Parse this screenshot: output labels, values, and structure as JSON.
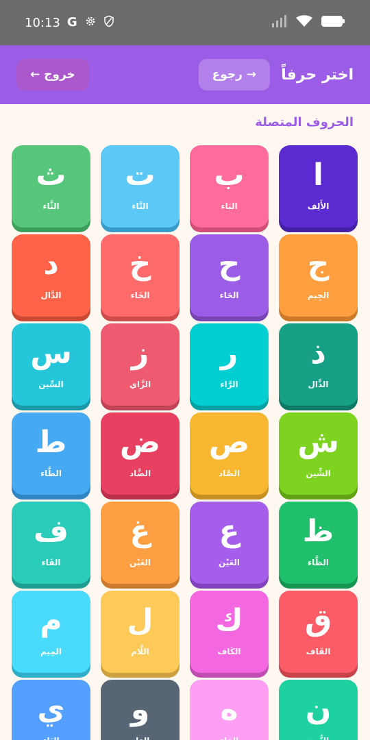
{
  "status": {
    "time": "10:13"
  },
  "header": {
    "title": "اختر حرفاً",
    "back_label": "→ رجوع",
    "exit_label": "خروج ←"
  },
  "section": {
    "title": "الحروف المتصلة"
  },
  "letters": [
    {
      "char": "ا",
      "name": "الأَلِف",
      "color": "#5B2BD1",
      "shade": "#4420A6"
    },
    {
      "char": "ب",
      "name": "البَاء",
      "color": "#FF6B9A",
      "shade": "#D14E78"
    },
    {
      "char": "ت",
      "name": "التَّاء",
      "color": "#5CC8F5",
      "shade": "#3A9BC7"
    },
    {
      "char": "ث",
      "name": "الثَّاء",
      "color": "#56C77A",
      "shade": "#3C9E5B"
    },
    {
      "char": "ج",
      "name": "الجِيم",
      "color": "#FF9F40",
      "shade": "#CC7A2A"
    },
    {
      "char": "ح",
      "name": "الحَاء",
      "color": "#9B5DE5",
      "shade": "#7845B5"
    },
    {
      "char": "خ",
      "name": "الخَاء",
      "color": "#FF6B6B",
      "shade": "#CF4C4C"
    },
    {
      "char": "د",
      "name": "الدَّال",
      "color": "#FF6347",
      "shade": "#CC4A33"
    },
    {
      "char": "ذ",
      "name": "الذَّال",
      "color": "#16A085",
      "shade": "#0E7A65"
    },
    {
      "char": "ر",
      "name": "الرَّاء",
      "color": "#00CED1",
      "shade": "#00A0A3"
    },
    {
      "char": "ز",
      "name": "الزَّاي",
      "color": "#EE5A6F",
      "shade": "#C04356"
    },
    {
      "char": "س",
      "name": "السِّين",
      "color": "#26C6DA",
      "shade": "#1A98A8"
    },
    {
      "char": "ش",
      "name": "الشِّين",
      "color": "#7ED321",
      "shade": "#5FA315"
    },
    {
      "char": "ص",
      "name": "الصَّاد",
      "color": "#F7B731",
      "shade": "#C68F1F"
    },
    {
      "char": "ض",
      "name": "الضَّاد",
      "color": "#E84060",
      "shade": "#B92E49"
    },
    {
      "char": "ط",
      "name": "الطَّاء",
      "color": "#45AAF2",
      "shade": "#2F84C2"
    },
    {
      "char": "ظ",
      "name": "الظَّاء",
      "color": "#20BF6B",
      "shade": "#159452"
    },
    {
      "char": "ع",
      "name": "العَيْن",
      "color": "#A55EEA",
      "shade": "#8043BD"
    },
    {
      "char": "غ",
      "name": "الغَيْن",
      "color": "#FF9F43",
      "shade": "#CC7B2E"
    },
    {
      "char": "ف",
      "name": "الفَاء",
      "color": "#2BCBBA",
      "shade": "#1D9E90"
    },
    {
      "char": "ق",
      "name": "القَاف",
      "color": "#FC5C65",
      "shade": "#C9434B"
    },
    {
      "char": "ك",
      "name": "الكَاف",
      "color": "#F368E0",
      "shade": "#C24DB2"
    },
    {
      "char": "ل",
      "name": "اللَّام",
      "color": "#FECA57",
      "shade": "#CCA03F"
    },
    {
      "char": "م",
      "name": "المِيم",
      "color": "#48DBFB",
      "shade": "#30AEC9"
    },
    {
      "char": "ن",
      "name": "النُّون",
      "color": "#1DD1A1",
      "shade": "#14A47D"
    },
    {
      "char": "ه",
      "name": "الهَاء",
      "color": "#FF9FF3",
      "shade": "#CC7CC2"
    },
    {
      "char": "و",
      "name": "الوَاو",
      "color": "#576574",
      "shade": "#3E4955"
    },
    {
      "char": "ي",
      "name": "اليَاء",
      "color": "#54A0FF",
      "shade": "#3B7CCC"
    }
  ]
}
